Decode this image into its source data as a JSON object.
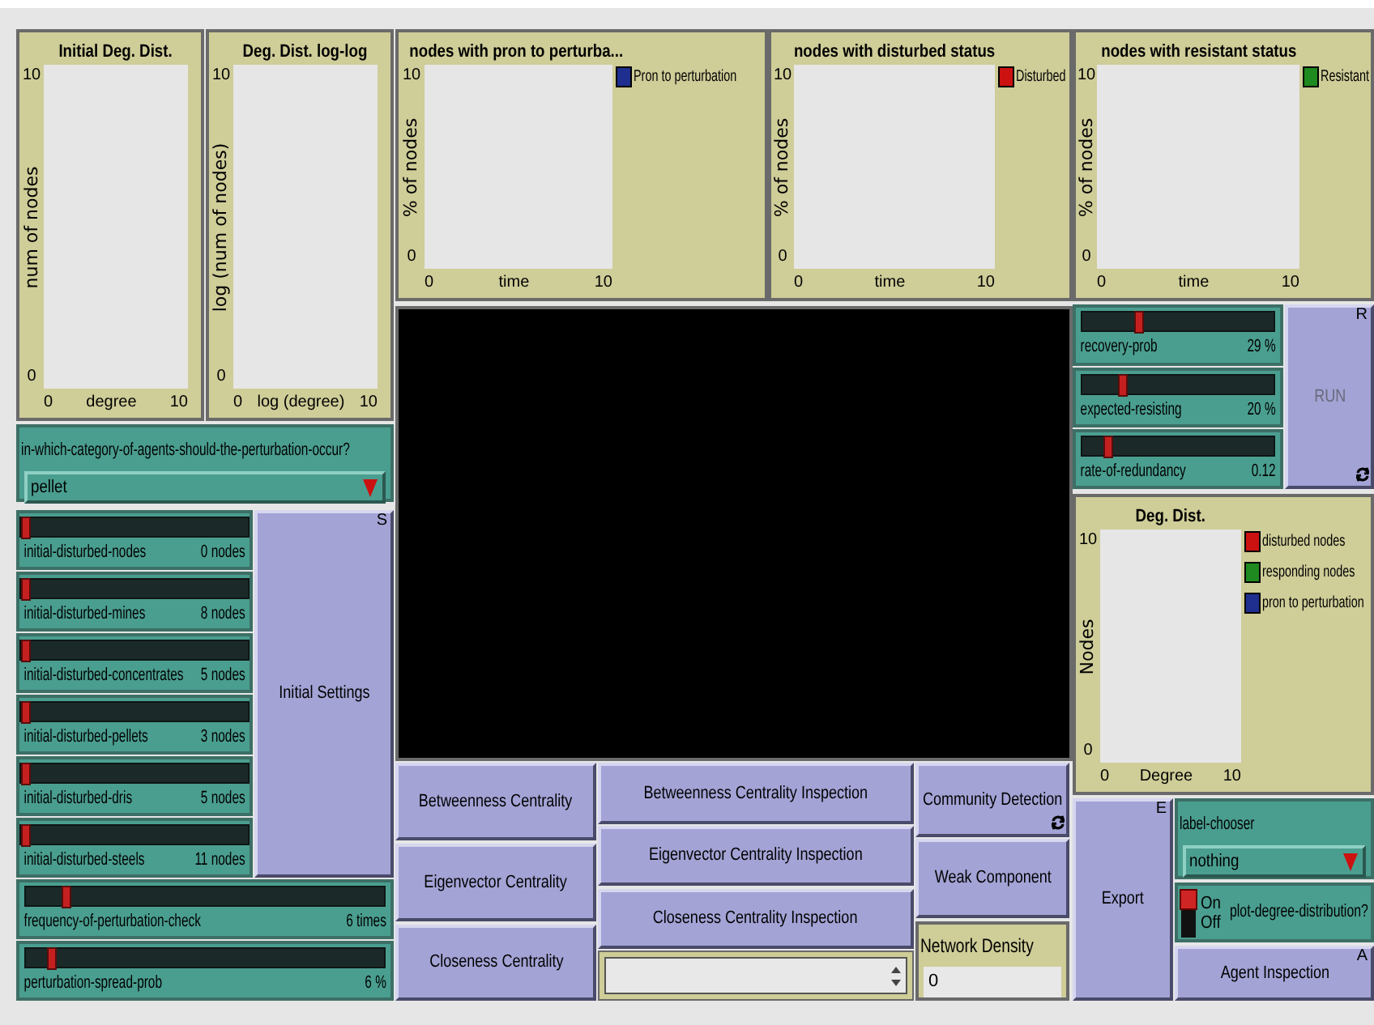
{
  "plots": [
    {
      "title": "Initial Deg. Dist.",
      "ylabel": "num of nodes",
      "xlabel": "degree",
      "ymin": "0",
      "ymax": "10",
      "xmin": "0",
      "xmax": "10"
    },
    {
      "title": "Deg. Dist. log-log",
      "ylabel": "log (num of nodes)",
      "xlabel": "log (degree)",
      "ymin": "0",
      "ymax": "10",
      "xmin": "0",
      "xmax": "10"
    },
    {
      "title": "nodes with pron to perturba...",
      "ylabel": "% of nodes",
      "xlabel": "time",
      "ymin": "0",
      "ymax": "10",
      "xmin": "0",
      "xmax": "10",
      "legend": [
        {
          "label": "Pron to perturbation",
          "color": "#1f2f8f"
        }
      ]
    },
    {
      "title": "nodes with disturbed status",
      "ylabel": "% of nodes",
      "xlabel": "time",
      "ymin": "0",
      "ymax": "10",
      "xmin": "0",
      "xmax": "10",
      "legend": [
        {
          "label": "Disturbed",
          "color": "#cc1111"
        }
      ]
    },
    {
      "title": "nodes with resistant status",
      "ylabel": "% of nodes",
      "xlabel": "time",
      "ymin": "0",
      "ymax": "10",
      "xmin": "0",
      "xmax": "10",
      "legend": [
        {
          "label": "Resistant",
          "color": "#1f8a1f"
        }
      ]
    },
    {
      "title": "Deg. Dist.",
      "ylabel": "Nodes",
      "xlabel": "Degree",
      "ymin": "0",
      "ymax": "10",
      "xmin": "0",
      "xmax": "10",
      "legend": [
        {
          "label": "disturbed nodes",
          "color": "#cc1111"
        },
        {
          "label": "responding nodes",
          "color": "#1f8a1f"
        },
        {
          "label": "pron to perturbation",
          "color": "#1f2f8f"
        }
      ]
    }
  ],
  "choosers": [
    {
      "label": "in-which-category-of-agents-should-the-perturbation-occur?",
      "value": "pellet"
    },
    {
      "label": "label-chooser",
      "value": "nothing"
    }
  ],
  "sliders": [
    {
      "label": "initial-disturbed-nodes",
      "value": "0 nodes",
      "level": 0
    },
    {
      "label": "initial-disturbed-mines",
      "value": "8 nodes",
      "level": 0
    },
    {
      "label": "initial-disturbed-concentrates",
      "value": "5 nodes",
      "level": 0
    },
    {
      "label": "initial-disturbed-pellets",
      "value": "3 nodes",
      "level": 0
    },
    {
      "label": "initial-disturbed-dris",
      "value": "5 nodes",
      "level": 0
    },
    {
      "label": "initial-disturbed-steels",
      "value": "11 nodes",
      "level": 0
    },
    {
      "label": "frequency-of-perturbation-check",
      "value": "6 times",
      "level": 0.1
    },
    {
      "label": "perturbation-spread-prob",
      "value": "6 %",
      "level": 0.06
    },
    {
      "label": "recovery-prob",
      "value": "29 %",
      "level": 0.29
    },
    {
      "label": "expected-resisting",
      "value": "20 %",
      "level": 0.2
    },
    {
      "label": "rate-of-redundancy",
      "value": "0.12",
      "level": 0.12
    }
  ],
  "buttons": [
    {
      "label": "Initial Settings",
      "key": "S",
      "forever": false,
      "disabled": false
    },
    {
      "label": "RUN",
      "key": "R",
      "forever": true,
      "disabled": true
    },
    {
      "label": "Betweenness Centrality",
      "forever": false,
      "disabled": false
    },
    {
      "label": "Betweenness Centrality Inspection",
      "forever": false,
      "disabled": false
    },
    {
      "label": "Community Detection",
      "forever": true,
      "disabled": false
    },
    {
      "label": "Export",
      "key": "E",
      "forever": false,
      "disabled": false
    },
    {
      "label": "Eigenvector Centrality",
      "forever": false,
      "disabled": false
    },
    {
      "label": "Eigenvector Centrality Inspection",
      "forever": false,
      "disabled": false
    },
    {
      "label": "Weak Component",
      "forever": false,
      "disabled": false
    },
    {
      "label": "Closeness Centrality",
      "forever": false,
      "disabled": false
    },
    {
      "label": "Closeness Centrality Inspection",
      "forever": false,
      "disabled": false
    },
    {
      "label": "Agent Inspection",
      "key": "A",
      "forever": false,
      "disabled": false
    }
  ],
  "monitor": {
    "label": "Network Density",
    "value": "0"
  },
  "switch": {
    "label": "plot-degree-distribution?",
    "on_label": "On",
    "off_label": "Off",
    "on": true
  }
}
